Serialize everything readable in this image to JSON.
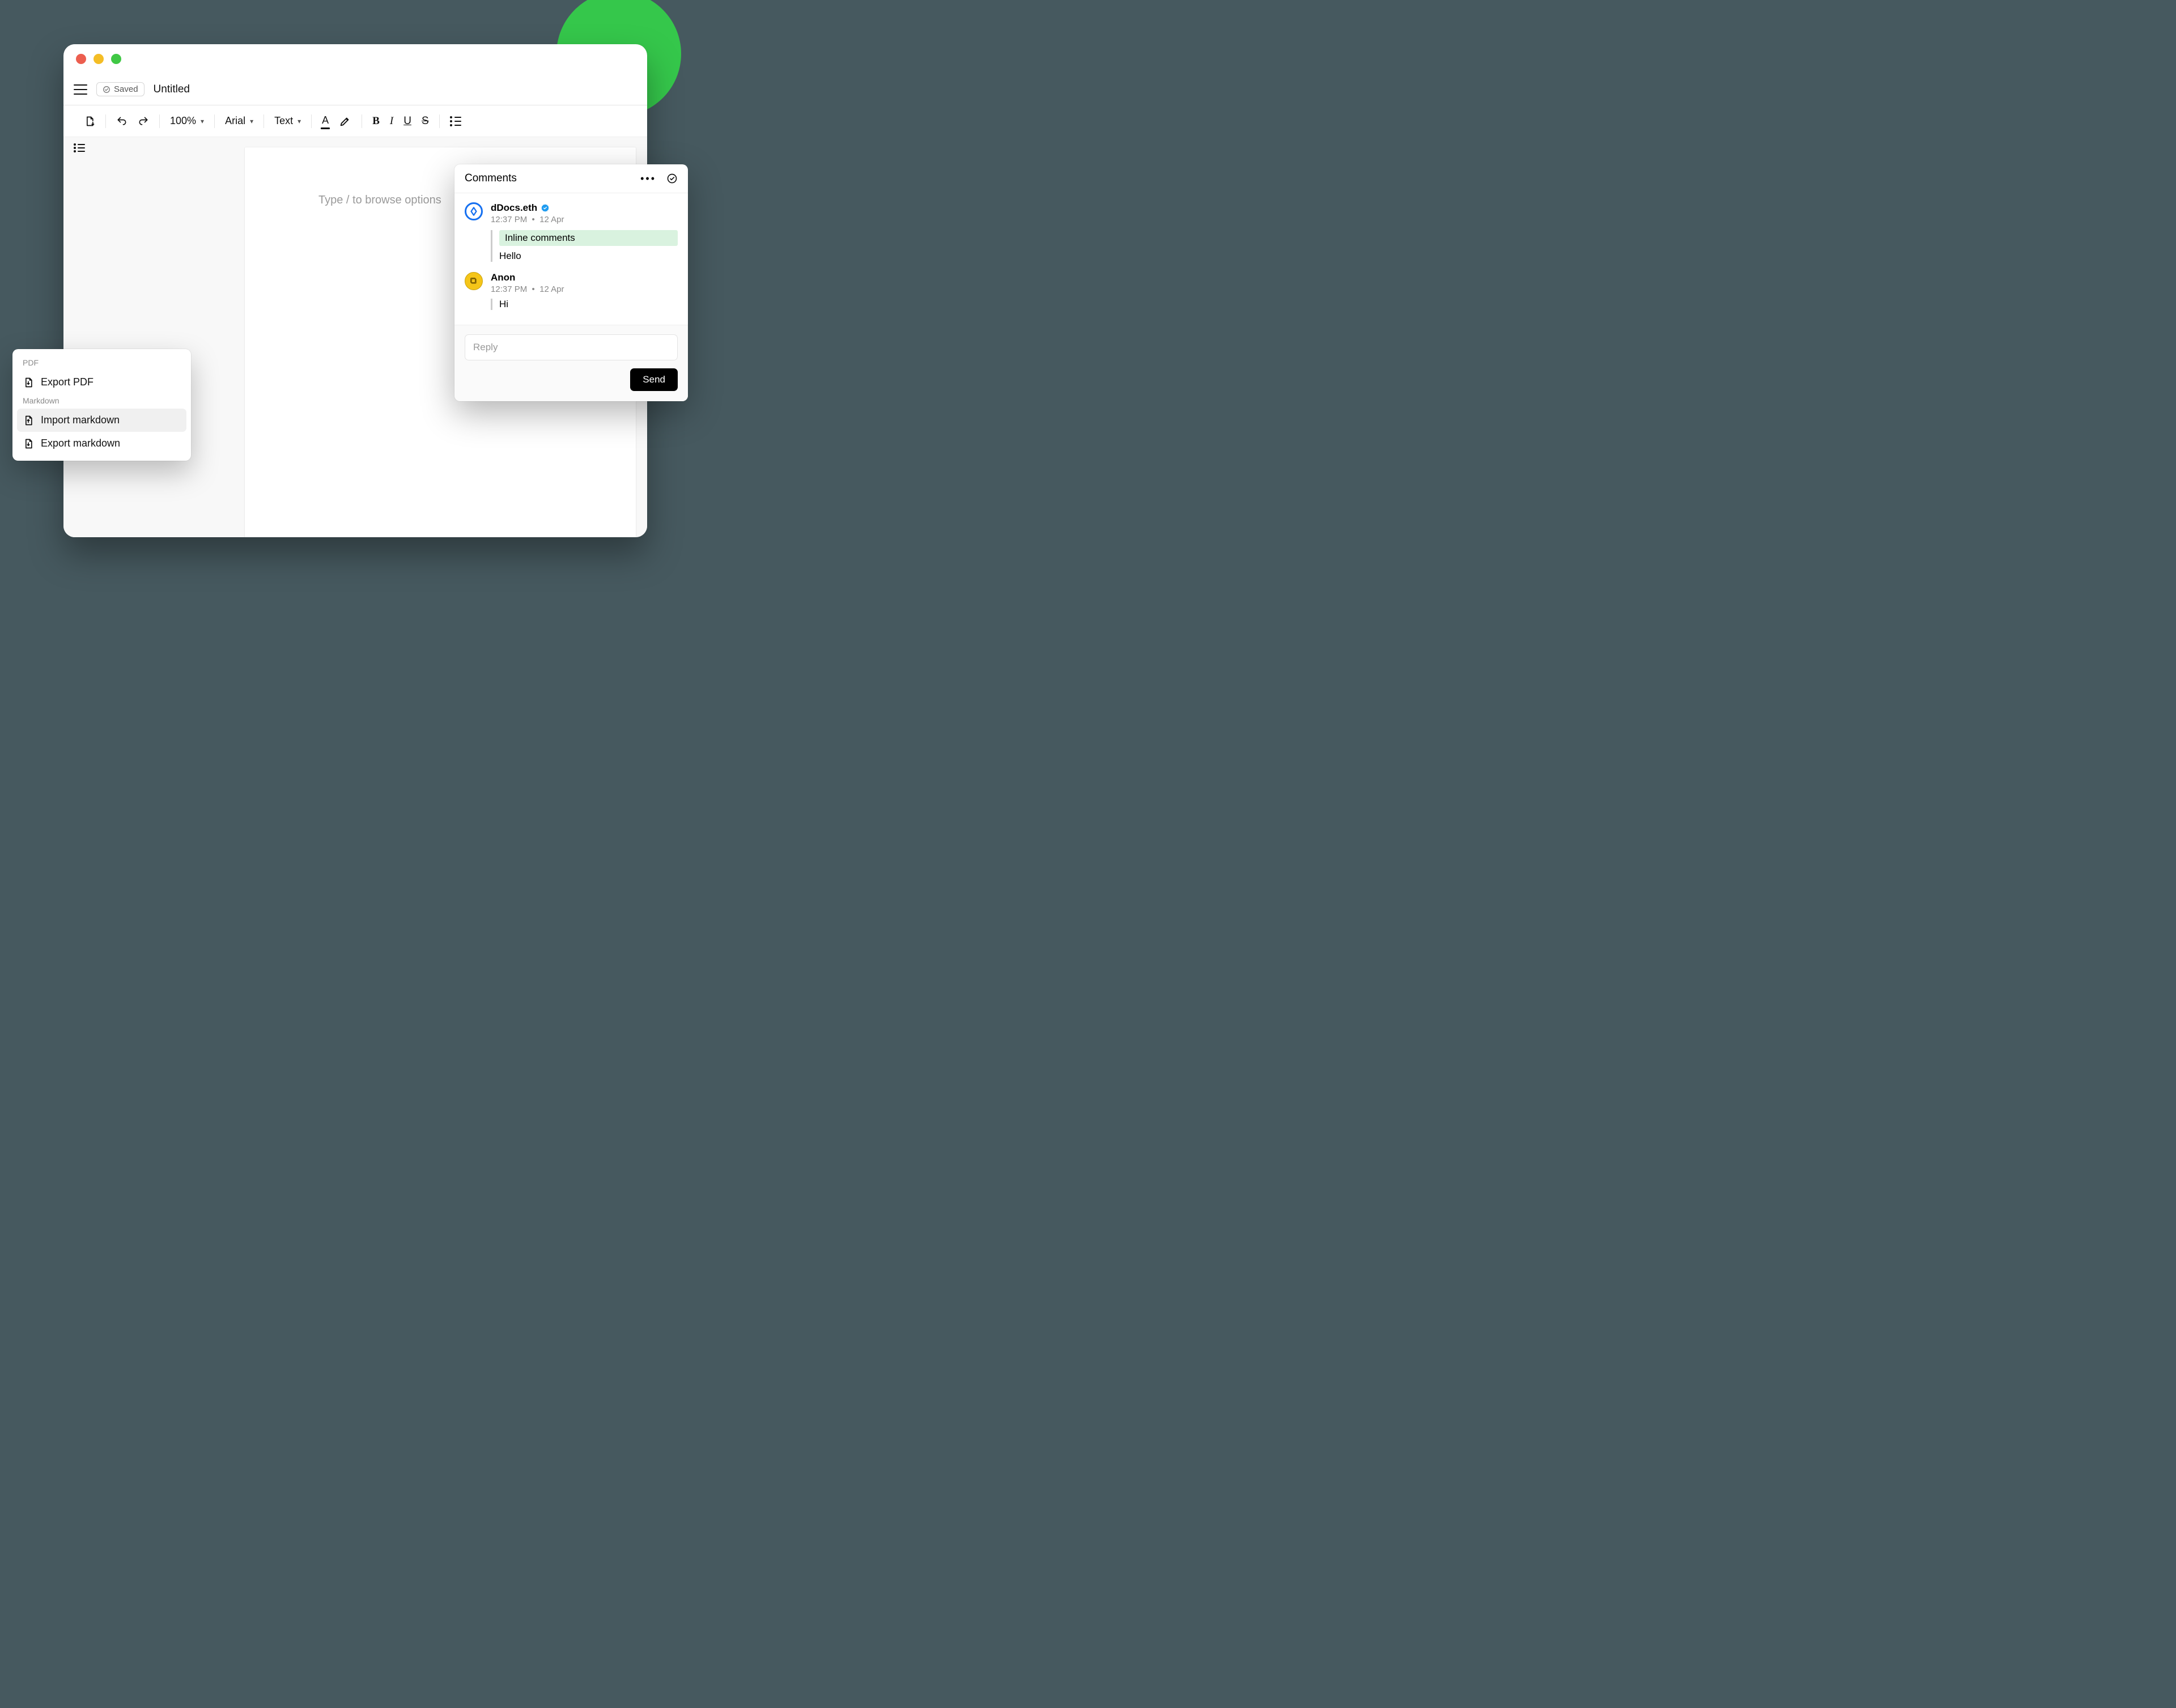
{
  "header": {
    "saved_badge": "Saved",
    "title": "Untitled"
  },
  "toolbar": {
    "zoom": "100%",
    "font": "Arial",
    "style": "Text"
  },
  "editor": {
    "placeholder": "Type / to browse options"
  },
  "export_menu": {
    "section_pdf": "PDF",
    "export_pdf": "Export PDF",
    "section_md": "Markdown",
    "import_md": "Import markdown",
    "export_md": "Export markdown"
  },
  "comments_panel": {
    "title": "Comments",
    "items": [
      {
        "user": "dDocs.eth",
        "verified": true,
        "time": "12:37 PM",
        "date": "12 Apr",
        "quote": "Inline comments",
        "text": "Hello"
      },
      {
        "user": "Anon",
        "verified": false,
        "time": "12:37 PM",
        "date": "12 Apr",
        "text": "Hi"
      }
    ],
    "reply_placeholder": "Reply",
    "send": "Send"
  }
}
